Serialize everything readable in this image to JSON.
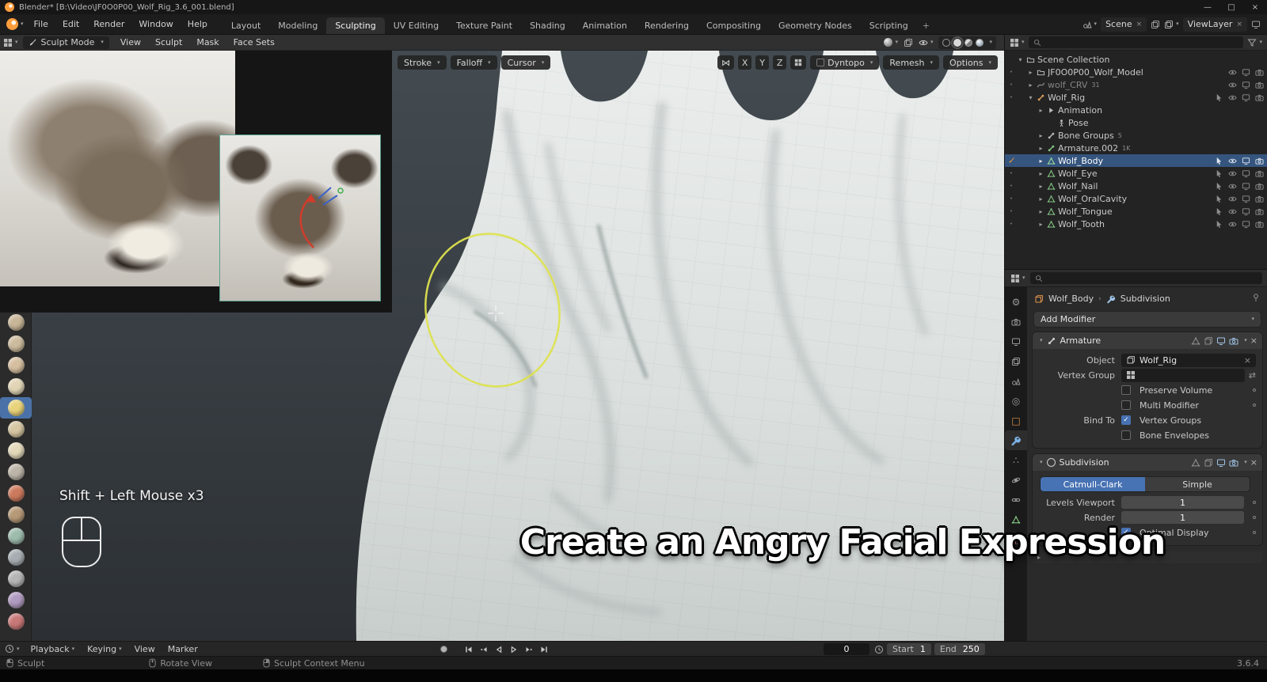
{
  "window": {
    "title": "Blender* [B:\\Video\\JF0O0P00_Wolf_Rig_3.6_001.blend]"
  },
  "topbar": {
    "menus": [
      "File",
      "Edit",
      "Render",
      "Window",
      "Help"
    ],
    "workspaces": [
      "Layout",
      "Modeling",
      "Sculpting",
      "UV Editing",
      "Texture Paint",
      "Shading",
      "Animation",
      "Rendering",
      "Compositing",
      "Geometry Nodes",
      "Scripting"
    ],
    "active_workspace": "Sculpting",
    "add_workspace": "+",
    "scene_label": "Scene",
    "viewlayer_label": "ViewLayer"
  },
  "tool_header": {
    "mode_label": "Sculpt Mode",
    "menus": [
      "View",
      "Sculpt",
      "Mask",
      "Face Sets"
    ]
  },
  "viewport": {
    "stroke": "Stroke",
    "falloff": "Falloff",
    "cursor": "Cursor",
    "axes": [
      "X",
      "Y",
      "Z"
    ],
    "dyntopo": "Dyntopo",
    "dyntopo_enabled": false,
    "remesh": "Remesh",
    "options": "Options",
    "shortcut_hint": "Shift + Left Mouse x3",
    "caption": "Create an Angry Facial Expression",
    "brush_color": "#dde24f"
  },
  "outliner": {
    "rows": [
      {
        "label": "Scene Collection"
      },
      {
        "label": "JF0O0P00_Wolf_Model"
      },
      {
        "label": "wolf_CRV",
        "badge": "31"
      },
      {
        "label": "Wolf_Rig"
      },
      {
        "label": "Animation"
      },
      {
        "label": "Pose"
      },
      {
        "label": "Bone Groups",
        "badge": "5"
      },
      {
        "label": "Armature.002",
        "badge": "1K"
      },
      {
        "label": "Wolf_Body",
        "selected": true
      },
      {
        "label": "Wolf_Eye"
      },
      {
        "label": "Wolf_Nail"
      },
      {
        "label": "Wolf_OralCavity"
      },
      {
        "label": "Wolf_Tongue"
      },
      {
        "label": "Wolf_Tooth"
      }
    ]
  },
  "properties": {
    "breadcrumb_object": "Wolf_Body",
    "breadcrumb_modifier": "Subdivision",
    "add_modifier_label": "Add Modifier",
    "armature": {
      "title": "Armature",
      "object_label": "Object",
      "object_value": "Wolf_Rig",
      "vertex_group_label": "Vertex Group",
      "preserve_volume_label": "Preserve Volume",
      "preserve_volume_checked": false,
      "multi_modifier_label": "Multi Modifier",
      "multi_modifier_checked": false,
      "bind_to_label": "Bind To",
      "vertex_groups_label": "Vertex Groups",
      "vertex_groups_checked": true,
      "bone_envelopes_label": "Bone Envelopes",
      "bone_envelopes_checked": false
    },
    "subdivision": {
      "title": "Subdivision",
      "mode_catmull": "Catmull-Clark",
      "mode_simple": "Simple",
      "active_mode": "Catmull-Clark",
      "levels_viewport_label": "Levels Viewport",
      "levels_viewport_value": "1",
      "render_label": "Render",
      "render_value": "1",
      "optimal_display_label": "Optimal Display",
      "optimal_display_checked": true
    }
  },
  "timeline": {
    "menus": [
      "Playback",
      "Keying",
      "View",
      "Marker"
    ],
    "current_frame": "0",
    "start_label": "Start",
    "start_value": "1",
    "end_label": "End",
    "end_value": "250"
  },
  "statusbar": {
    "left_action": "Sculpt",
    "middle_action": "Rotate View",
    "right_action": "Sculpt Context Menu",
    "version": "3.6.4"
  }
}
